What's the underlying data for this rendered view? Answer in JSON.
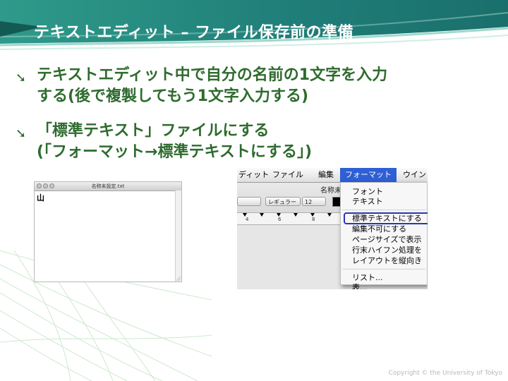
{
  "slide": {
    "title": "テキストエディット – ファイル保存前の準備",
    "bullets": [
      {
        "icon": "arrow-bullet-icon",
        "line1": "テキストエディット中で自分の名前の1文字を入力",
        "line2": "する(後で複製してもう1文字入力する)"
      },
      {
        "icon": "arrow-bullet-icon",
        "line1": "「標準テキスト」ファイルにする",
        "line2": "(「フォーマット→標準テキストにする」)"
      }
    ],
    "copyright": "Copyright © the University of Tokyo"
  },
  "doc_window": {
    "title": "名称未設定.txt",
    "content": "山"
  },
  "app": {
    "menubar": {
      "edit_partial": "ディット",
      "file": "ファイル",
      "edit": "編集",
      "format": "フォーマット",
      "window_partial": "ウイン"
    },
    "window_name_partial": "名称未",
    "toolbar": {
      "popup_style": "レギュラー",
      "popup_size": "12"
    },
    "ruler": {
      "labels": [
        "4",
        "6",
        "8"
      ]
    },
    "format_menu": {
      "items": [
        "フォント",
        "テキスト",
        "標準テキストにする",
        "編集不可にする",
        "ページサイズで表示",
        "行末ハイフン処理を",
        "レイアウトを縦向き",
        "リスト...",
        "表..."
      ],
      "highlighted_item": "標準テキストにする"
    }
  },
  "colors": {
    "header_teal": "#1f7a78",
    "bullet_green": "#2e6b2e",
    "menu_selected": "#2e5fd4",
    "highlight_outline": "#2a35b8"
  }
}
